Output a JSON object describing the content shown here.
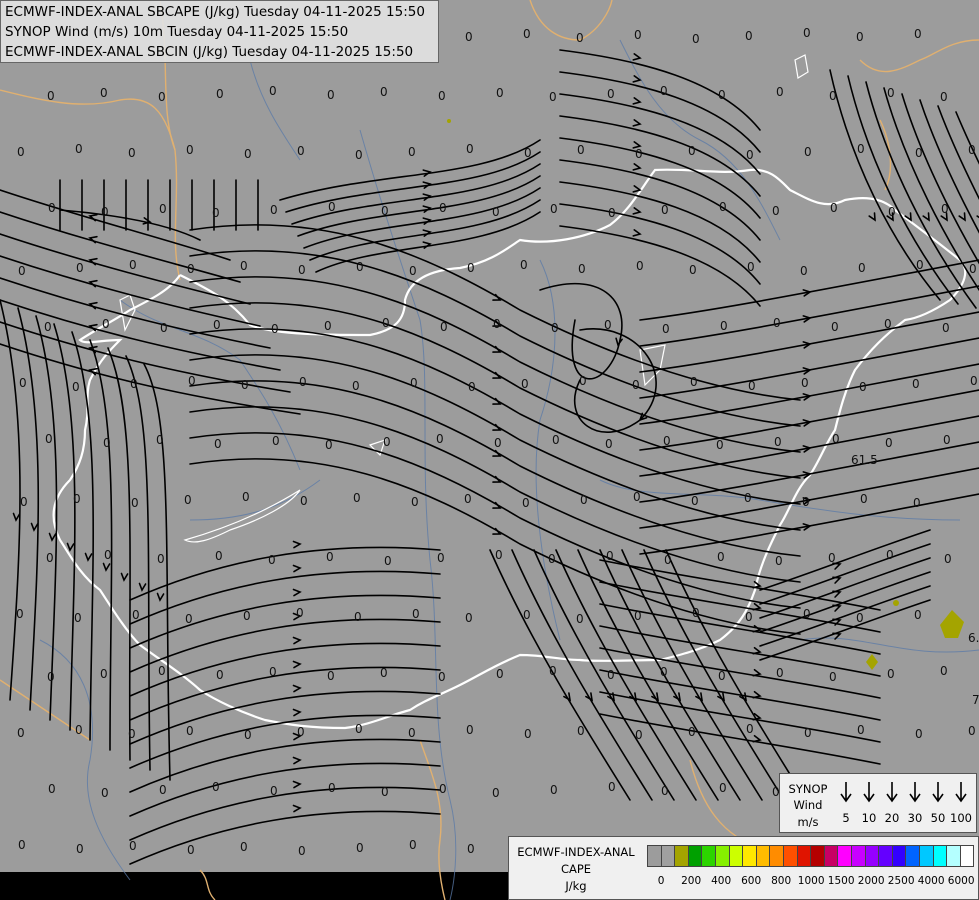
{
  "header": {
    "line1": "ECMWF-INDEX-ANAL SBCAPE (J/kg) Tuesday 04-11-2025 15:50",
    "line2": "SYNOP Wind (m/s) 10m Tuesday 04-11-2025 15:50",
    "line3": "ECMWF-INDEX-ANAL SBCIN (J/kg) Tuesday 04-11-2025 15:50"
  },
  "synop_legend": {
    "title1": "SYNOP",
    "title2": "Wind",
    "unit": "m/s",
    "speeds": [
      "5",
      "10",
      "20",
      "30",
      "50",
      "100"
    ]
  },
  "cape_legend": {
    "title1": "ECMWF-INDEX-ANAL",
    "title2": "CAPE",
    "unit": "J/kg",
    "colors": [
      "#9c9c9c",
      "#a0a0a0",
      "#a4a400",
      "#00a000",
      "#2cd400",
      "#86f000",
      "#ccff00",
      "#ffe800",
      "#ffbc00",
      "#ff8c00",
      "#ff5000",
      "#e01400",
      "#b40000",
      "#c80064",
      "#ff00ff",
      "#c800ff",
      "#9600ff",
      "#6400ff",
      "#3200ff",
      "#0064ff",
      "#00c8ff",
      "#00ffff",
      "#b4ffff",
      "#ffffff"
    ],
    "ticks": [
      "0",
      "200",
      "400",
      "600",
      "800",
      "1000",
      "1500",
      "2000",
      "2500",
      "4000",
      "6000"
    ]
  },
  "map": {
    "background": "#9c9c9c",
    "value_labels": [
      "0",
      "61.5",
      "6.",
      "7"
    ]
  }
}
